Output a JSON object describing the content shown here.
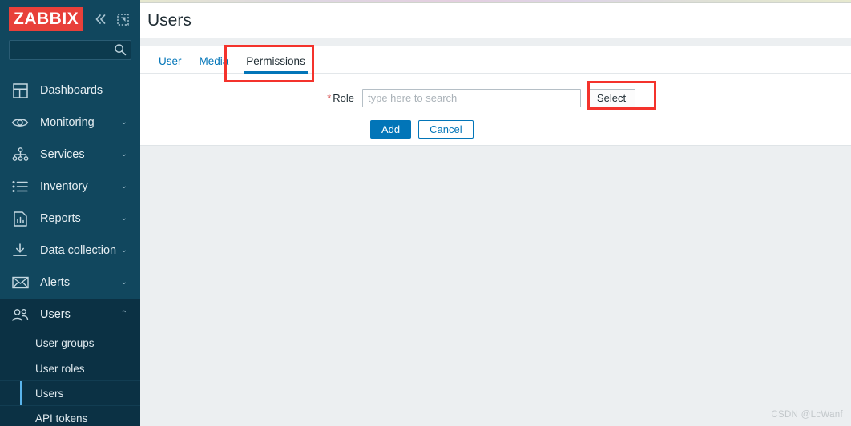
{
  "sidebar": {
    "logo_text": "ZABBIX",
    "collapse_icon": "double-chevron-left-icon",
    "kiosk_icon": "kiosk-mode-icon",
    "search": {
      "value": "",
      "placeholder": "",
      "icon": "search-icon"
    },
    "items": [
      {
        "label": "Dashboards",
        "icon": "dashboard-grid-icon",
        "chevron": "",
        "expandable": false
      },
      {
        "label": "Monitoring",
        "icon": "eye-icon",
        "chevron": "⌄",
        "expandable": true
      },
      {
        "label": "Services",
        "icon": "sitemap-icon",
        "chevron": "⌄",
        "expandable": true
      },
      {
        "label": "Inventory",
        "icon": "list-icon",
        "chevron": "⌄",
        "expandable": true
      },
      {
        "label": "Reports",
        "icon": "report-bars-icon",
        "chevron": "⌄",
        "expandable": true
      },
      {
        "label": "Data collection",
        "icon": "download-icon",
        "chevron": "⌄",
        "expandable": true
      },
      {
        "label": "Alerts",
        "icon": "envelope-icon",
        "chevron": "⌄",
        "expandable": true
      },
      {
        "label": "Users",
        "icon": "users-icon",
        "chevron": "⌃",
        "expandable": true,
        "expanded": true
      }
    ],
    "submenu": [
      {
        "label": "User groups",
        "selected": false
      },
      {
        "label": "User roles",
        "selected": false
      },
      {
        "label": "Users",
        "selected": true
      },
      {
        "label": "API tokens",
        "selected": false
      }
    ],
    "colors": {
      "background": "#11475e",
      "submenu_background": "#0b3144",
      "logo_red": "#e8403a",
      "active_accent": "#5ab4ec"
    }
  },
  "header": {
    "title": "Users"
  },
  "form": {
    "tabs": [
      {
        "label": "User",
        "selected": false
      },
      {
        "label": "Media",
        "selected": false
      },
      {
        "label": "Permissions",
        "selected": true
      }
    ],
    "role_field": {
      "required_marker": "*",
      "label": "Role",
      "value": "",
      "placeholder": "type here to search",
      "select_button": "Select"
    },
    "buttons": {
      "add": "Add",
      "cancel": "Cancel"
    }
  },
  "annotations": {
    "highlight_color": "#f4332c",
    "boxes": [
      {
        "name": "permissions-tab-highlight"
      },
      {
        "name": "select-button-highlight"
      }
    ]
  },
  "watermark": {
    "text": "CSDN @LcWanf"
  }
}
